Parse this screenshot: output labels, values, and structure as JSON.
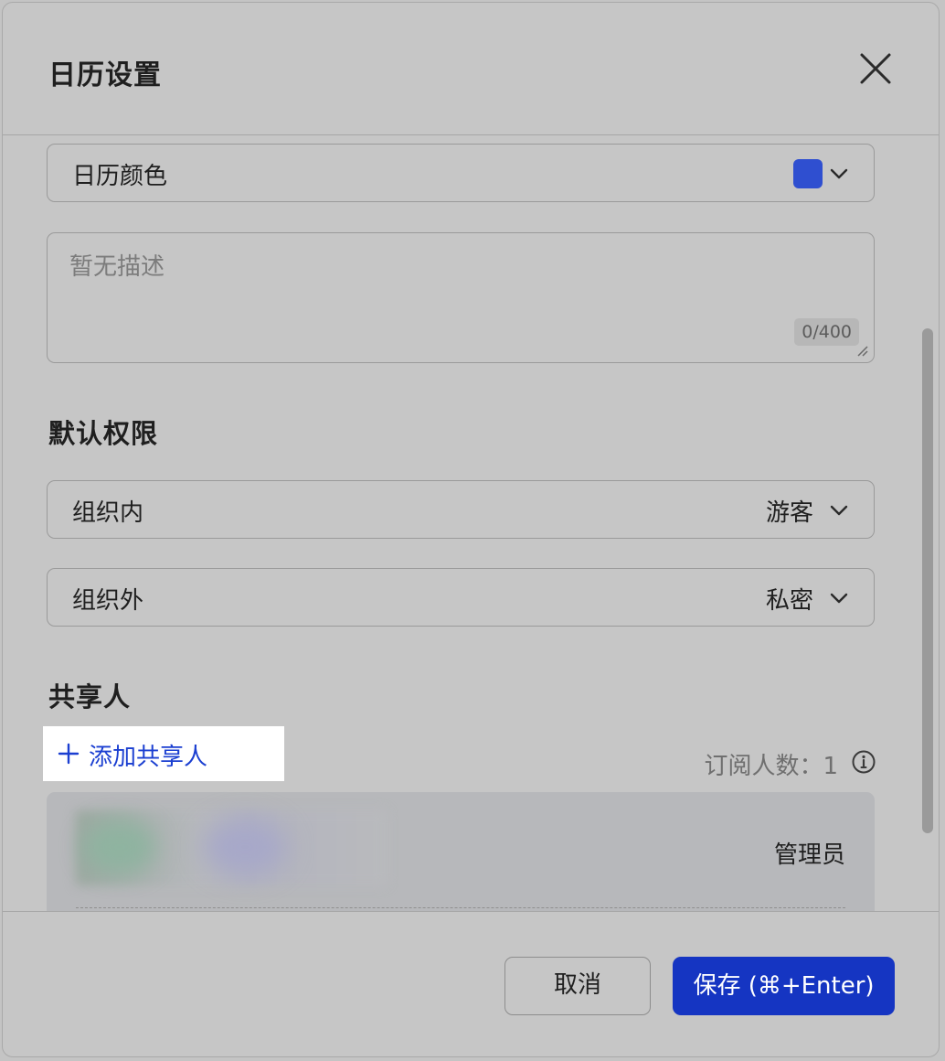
{
  "dialog": {
    "title": "日历设置"
  },
  "fields": {
    "calendar_color": {
      "label": "日历颜色",
      "color": "#2f4fd0"
    },
    "description": {
      "placeholder": "暂无描述",
      "counter": "0/400"
    }
  },
  "permissions": {
    "section_title": "默认权限",
    "inside_org": {
      "label": "组织内",
      "value": "游客"
    },
    "outside_org": {
      "label": "组织外",
      "value": "私密"
    }
  },
  "sharers": {
    "section_title": "共享人",
    "add_label": "添加共享人",
    "subscriber_count": "订阅人数：1",
    "entries": [
      {
        "role": "管理员"
      }
    ]
  },
  "footer": {
    "cancel_label": "取消",
    "save_label": "保存 (⌘+Enter)"
  },
  "colors": {
    "accent": "#1535c2",
    "link": "#1b3fd1"
  }
}
